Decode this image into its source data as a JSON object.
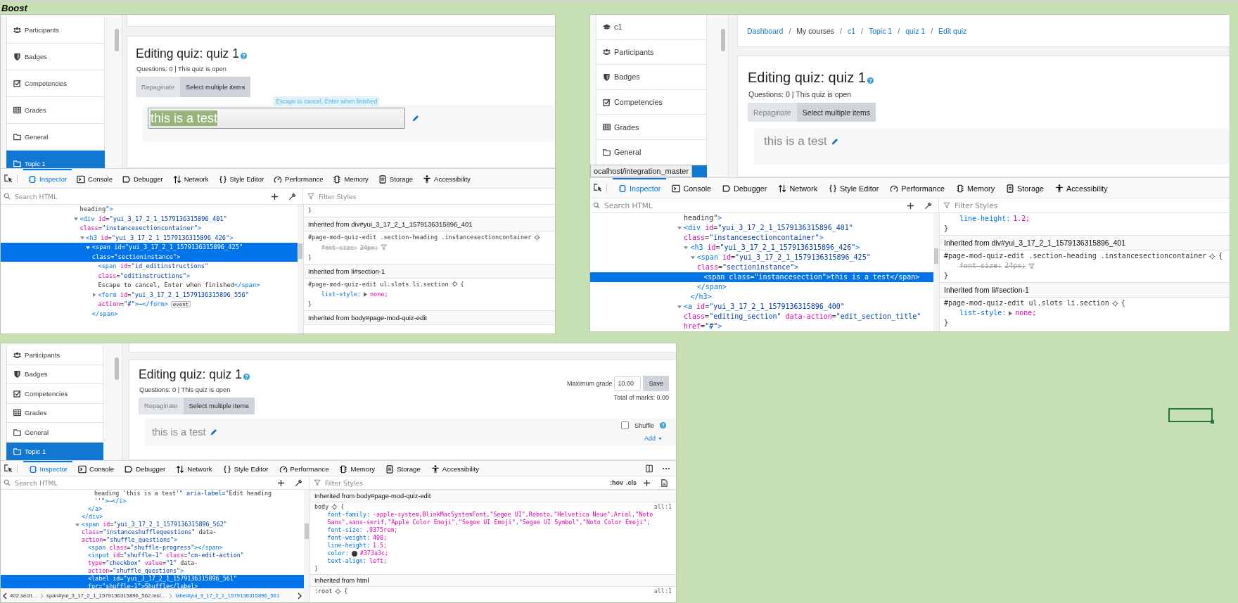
{
  "sheet": {
    "title": "Boost"
  },
  "panels": [
    {
      "sidebar": {
        "items": [
          {
            "label": "Participants",
            "kind": "participants",
            "selected": false
          },
          {
            "label": "Badges",
            "kind": "badges",
            "selected": false
          },
          {
            "label": "Competencies",
            "kind": "competencies",
            "selected": false
          },
          {
            "label": "Grades",
            "kind": "grades",
            "selected": false
          },
          {
            "label": "General",
            "kind": "section",
            "selected": false
          },
          {
            "label": "Topic 1",
            "kind": "section",
            "selected": true
          }
        ]
      },
      "page": {
        "title": "Editing quiz: quiz 1",
        "info": "Questions: 0 | This quiz is open",
        "buttons": [
          {
            "label": "Repaginate",
            "disabled": true
          },
          {
            "label": "Select multiple items",
            "disabled": false
          }
        ],
        "section": {
          "heading": "this is a test",
          "editing": true,
          "hint": "Escape to cancel, Enter when finished"
        }
      },
      "devtools": {
        "tabs": [
          {
            "label": "Inspector",
            "selected": true
          },
          {
            "label": "Console",
            "selected": false
          },
          {
            "label": "Debugger",
            "selected": false
          },
          {
            "label": "Network",
            "selected": false
          },
          {
            "label": "Style Editor",
            "selected": false
          },
          {
            "label": "Performance",
            "selected": false
          },
          {
            "label": "Memory",
            "selected": false
          },
          {
            "label": "Storage",
            "selected": false
          },
          {
            "label": "Accessibility",
            "selected": false
          }
        ],
        "options_menu": false,
        "search_placeholder": "Search HTML",
        "filter_placeholder": "Filter Styles",
        "html": [
          {
            "selected": false,
            "lines": [
              "heading\">"
            ]
          },
          {
            "expanded": true,
            "selected": false,
            "lines": [
              "<div id=\"yui_3_17_2_1_1579136315896_401\"",
              "class=\"instancesectioncontainer\">"
            ],
            "children": [
              {
                "expanded": true,
                "selected": false,
                "lines": [
                  "<h3 id=\"yui_3_17_2_1_1579136315896_426\">"
                ],
                "children": [
                  {
                    "expanded": true,
                    "selected": true,
                    "lines": [
                      "<span id=\"yui_3_17_2_1_1579136315896_425\"",
                      "class=\"sectioninstance\">"
                    ],
                    "children": [
                      {
                        "selected": false,
                        "lines": [
                          "<span id=\"id_editinstructions\"",
                          "class=\"editinstructions\">",
                          "Escape to cancel, Enter when finished</span>"
                        ]
                      },
                      {
                        "expanded": false,
                        "selected": false,
                        "lines": [
                          "<form id=\"yui_3_17_2_1_1579136315896_556\"",
                          "action=\"#\">⋯</form>"
                        ],
                        "badge": "event"
                      }
                    ],
                    "close": "</span>"
                  }
                ]
              }
            ]
          }
        ],
        "styles": [
          {
            "kind": "rule",
            "close": "}"
          },
          {
            "kind": "header",
            "text": "Inherited from div#yui_3_17_2_1_1579136315896_401"
          },
          {
            "kind": "rule",
            "selector": "#page-mod-quiz-edit .section-heading .instancesectioncontainer",
            "props": [
              {
                "name": "font-size:",
                "value": "24px;",
                "struck": true,
                "expandable": false
              }
            ],
            "close": "}"
          },
          {
            "kind": "header",
            "text": "Inherited from li#section-1"
          },
          {
            "kind": "rule",
            "selector": "#page-mod-quiz-edit ul.slots li.section",
            "brace": "{",
            "props": [
              {
                "name": "list-style:",
                "value": "none;",
                "struck": false,
                "expandable": true
              }
            ],
            "close": "}"
          },
          {
            "kind": "header",
            "text": "Inherited from body#page-mod-quiz-edit"
          }
        ]
      }
    },
    {
      "sidebar": {
        "items": [
          {
            "label": "c1",
            "kind": "course",
            "selected": false
          },
          {
            "label": "Participants",
            "kind": "participants",
            "selected": false
          },
          {
            "label": "Badges",
            "kind": "badges",
            "selected": false
          },
          {
            "label": "Competencies",
            "kind": "competencies",
            "selected": false
          },
          {
            "label": "Grades",
            "kind": "grades",
            "selected": false
          },
          {
            "label": "General",
            "kind": "section",
            "selected": false
          },
          {
            "kind": "section",
            "selected": true
          }
        ],
        "status_tooltip": "ocalhost/integration_master"
      },
      "page": {
        "breadcrumb": {
          "separator": "/",
          "items": [
            {
              "label": "Dashboard",
              "link": true
            },
            {
              "label": "My courses",
              "link": false
            },
            {
              "label": "c1",
              "link": true
            },
            {
              "label": "Topic 1",
              "link": true
            },
            {
              "label": "quiz 1",
              "link": true
            },
            {
              "label": "Edit quiz",
              "link": true
            }
          ]
        },
        "title": "Editing quiz: quiz 1",
        "info": "Questions: 0 | This quiz is open",
        "buttons": [
          {
            "label": "Repaginate",
            "disabled": true
          },
          {
            "label": "Select multiple items",
            "disabled": false
          }
        ],
        "section": {
          "heading": "this is a test",
          "editing": false
        }
      },
      "devtools": {
        "tabs": [
          {
            "label": "Inspector",
            "selected": true
          },
          {
            "label": "Console",
            "selected": false
          },
          {
            "label": "Debugger",
            "selected": false
          },
          {
            "label": "Network",
            "selected": false
          },
          {
            "label": "Style Editor",
            "selected": false
          },
          {
            "label": "Performance",
            "selected": false
          },
          {
            "label": "Memory",
            "selected": false
          },
          {
            "label": "Storage",
            "selected": false
          },
          {
            "label": "Accessibility",
            "selected": false
          }
        ],
        "options_menu": false,
        "search_placeholder": "Search HTML",
        "filter_placeholder": "Filter Styles",
        "html": [
          {
            "selected": false,
            "lines": [
              "heading\">"
            ]
          },
          {
            "expanded": true,
            "selected": false,
            "lines": [
              "<div id=\"yui_3_17_2_1_1579136315896_401\"",
              "class=\"instancesectioncontainer\">"
            ],
            "children": [
              {
                "expanded": true,
                "selected": false,
                "lines": [
                  "<h3 id=\"yui_3_17_2_1_1579136315896_426\">"
                ],
                "children": [
                  {
                    "expanded": true,
                    "selected": false,
                    "lines": [
                      "<span id=\"yui_3_17_2_1_1579136315896_425\"",
                      "class=\"sectioninstance\">"
                    ],
                    "children": [
                      {
                        "selected": true,
                        "lines": [
                          "<span class=\"instancesection\">this is a test</span>"
                        ]
                      }
                    ],
                    "close": "</span>"
                  }
                ],
                "close": "</h3>"
              }
            ]
          },
          {
            "expanded": true,
            "selected": false,
            "lines": [
              "<a id=\"yui_3_17_2_1_1579136315896_400\"",
              "class=\"editing_section\" data-action=\"edit_section_title\"",
              "href=\"#\">"
            ]
          }
        ],
        "styles": [
          {
            "kind": "rule",
            "props": [
              {
                "name": "line-height:",
                "value": "1.2;",
                "struck": false,
                "expandable": false
              }
            ],
            "close": "}"
          },
          {
            "kind": "header",
            "text": "Inherited from div#yui_3_17_2_1_1579136315896_401"
          },
          {
            "kind": "rule",
            "selector": "#page-mod-quiz-edit .section-heading .instancesectioncontainer",
            "brace": "{",
            "props": [
              {
                "name": "font-size:",
                "value": "24px;",
                "struck": true,
                "expandable": false
              }
            ],
            "close": "}"
          },
          {
            "kind": "header",
            "text": "Inherited from li#section-1"
          },
          {
            "kind": "rule",
            "selector": "#page-mod-quiz-edit ul.slots li.section",
            "brace": "{",
            "props": [
              {
                "name": "list-style:",
                "value": "none;",
                "struck": false,
                "expandable": true
              }
            ],
            "close": "}"
          }
        ]
      }
    },
    {
      "sidebar": {
        "items": [
          {
            "label": "Participants",
            "kind": "participants",
            "selected": false
          },
          {
            "label": "Badges",
            "kind": "badges",
            "selected": false
          },
          {
            "label": "Competencies",
            "kind": "competencies",
            "selected": false
          },
          {
            "label": "Grades",
            "kind": "grades",
            "selected": false
          },
          {
            "label": "General",
            "kind": "section",
            "selected": false
          },
          {
            "label": "Topic 1",
            "kind": "section",
            "selected": true
          }
        ]
      },
      "page": {
        "title": "Editing quiz: quiz 1",
        "info": "Questions: 0 | This quiz is open",
        "buttons": [
          {
            "label": "Repaginate",
            "disabled": true
          },
          {
            "label": "Select multiple items",
            "disabled": false
          }
        ],
        "grade": {
          "label": "Maximum grade",
          "value": "10.00",
          "button": "Save",
          "total": "Total of marks: 0.00"
        },
        "section": {
          "heading": "this is a test",
          "editing": false,
          "shuffle": {
            "label": "Shuffle",
            "checked": false
          },
          "add": "Add"
        }
      },
      "devtools": {
        "tabs": [
          {
            "label": "Inspector",
            "selected": true
          },
          {
            "label": "Console",
            "selected": false
          },
          {
            "label": "Debugger",
            "selected": false
          },
          {
            "label": "Network",
            "selected": false
          },
          {
            "label": "Style Editor",
            "selected": false
          },
          {
            "label": "Performance",
            "selected": false
          },
          {
            "label": "Memory",
            "selected": false
          },
          {
            "label": "Storage",
            "selected": false
          },
          {
            "label": "Accessibility",
            "selected": false
          }
        ],
        "options_menu": true,
        "search_placeholder": "Search HTML",
        "filter_placeholder": "Filter Styles",
        "style_tools": [
          ":hov",
          ".cls"
        ],
        "html": [
          {
            "close": "</div>",
            "children": [
              {
                "close": "</a>",
                "children": [
                  {
                    "selected": false,
                    "lines": [
                      "heading 'this is a test'\" aria-label=\"Edit heading",
                      "''\">⋯</i>"
                    ]
                  }
                ]
              }
            ]
          },
          {
            "expanded": true,
            "selected": false,
            "lines": [
              "<span id=\"yui_3_17_2_1_1579136315896_562\"",
              "class=\"instanceshufflequestions\" data-",
              "action=\"shuffle_questions\">"
            ],
            "children": [
              {
                "selected": false,
                "lines": [
                  "<span class=\"shuffle-progress\"></span>"
                ]
              },
              {
                "selected": false,
                "lines": [
                  "<input id=\"shuffle-1\" class=\"cm-edit-action\"",
                  "type=\"checkbox\" value=\"1\" data-",
                  "action=\"shuffle_questions\">"
                ]
              },
              {
                "selected": true,
                "lines": [
                  "<label id=\"yui_3_17_2_1_1579136315896_561\"",
                  "for=\"shuffle-1\">Shuffle</label>"
                ]
              }
            ]
          }
        ],
        "styles": [
          {
            "kind": "header",
            "text": "Inherited from body#page-mod-quiz-edit"
          },
          {
            "kind": "rule",
            "selector": "body",
            "brace": "{",
            "source": "all:1",
            "props": [
              {
                "name": "font-family:",
                "value": "-apple-system,BlinkMacSystemFont,\"Segoe UI\",Roboto,\"Helvetica Neue\",Arial,\"Noto Sans\",sans-serif,\"Apple Color Emoji\",\"Segoe UI Emoji\",\"Segoe UI Symbol\",\"Noto Color Emoji\";",
                "struck": false,
                "expandable": false
              },
              {
                "name": "font-size:",
                "value": ".9375rem;",
                "struck": false,
                "expandable": false
              },
              {
                "name": "font-weight:",
                "value": "400;",
                "struck": false,
                "expandable": false
              },
              {
                "name": "line-height:",
                "value": "1.5;",
                "struck": false,
                "expandable": false
              },
              {
                "name": "color:",
                "value": "#373a3c;",
                "color": "#373a3c",
                "struck": false,
                "expandable": false
              },
              {
                "name": "text-align:",
                "value": "left;",
                "struck": false,
                "expandable": false
              }
            ],
            "close": "}"
          },
          {
            "kind": "header",
            "text": "Inherited from html"
          },
          {
            "kind": "rule",
            "selector": ":root",
            "brace": "{",
            "source": "all:1"
          }
        ],
        "crumbs": [
          {
            "label": "402.secti…",
            "selected": false
          },
          {
            "label": "span#yui_3_17_2_1_1579136315896_562.inst…",
            "selected": false
          },
          {
            "label": "label#yui_3_17_2_1_1579136315896_561",
            "selected": true
          }
        ]
      }
    }
  ]
}
